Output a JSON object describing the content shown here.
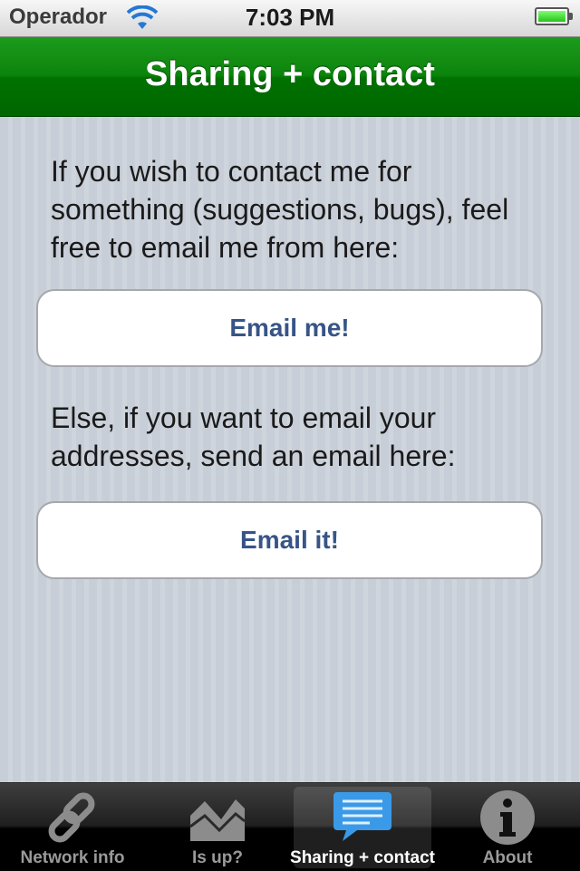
{
  "status_bar": {
    "carrier": "Operador",
    "time": "7:03 PM",
    "wifi_icon": "wifi-icon",
    "battery_icon": "battery-icon",
    "battery_color": "#27c31c"
  },
  "nav": {
    "title": "Sharing + contact",
    "color": "#0c840c"
  },
  "content": {
    "paragraph1": "If you wish to contact me for something (suggestions, bugs), feel free to email me from here:",
    "button1_label": "Email me!",
    "paragraph2": "Else, if you want to email your addresses, send an email here:",
    "button2_label": "Email it!",
    "button_text_color": "#385487"
  },
  "tabbar": {
    "tabs": [
      {
        "label": "Network info",
        "icon": "chain-link-icon",
        "selected": false
      },
      {
        "label": "Is up?",
        "icon": "area-chart-icon",
        "selected": false
      },
      {
        "label": "Sharing + contact",
        "icon": "speech-bubble-icon",
        "selected": true
      },
      {
        "label": "About",
        "icon": "info-icon",
        "selected": false
      }
    ]
  }
}
